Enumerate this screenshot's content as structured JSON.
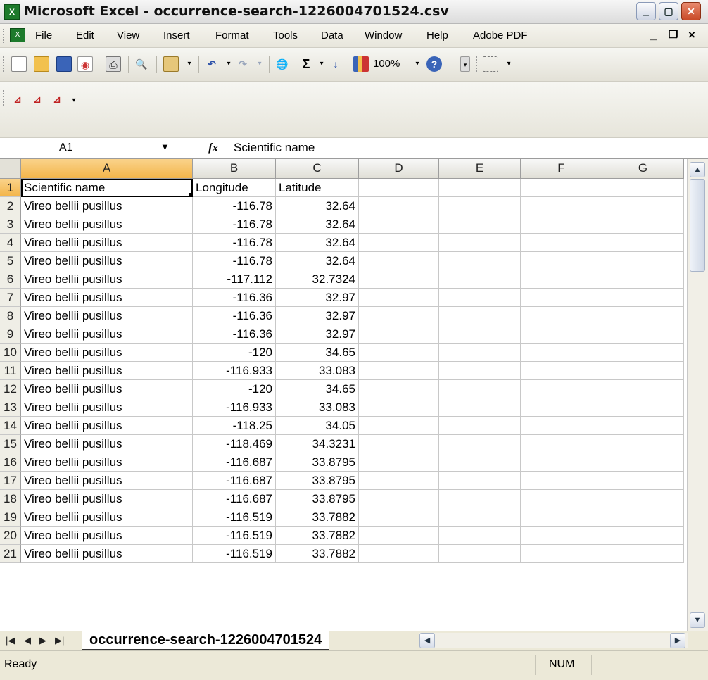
{
  "window": {
    "title": "Microsoft Excel - occurrence-search-1226004701524.csv",
    "app_icon": "excel-icon",
    "controls": [
      "minimize-icon",
      "maximize-icon",
      "close-icon"
    ]
  },
  "menu": {
    "items": [
      "File",
      "Edit",
      "View",
      "Insert",
      "Format",
      "Tools",
      "Data",
      "Window",
      "Help",
      "Adobe PDF"
    ],
    "doc_icon": "workbook-icon",
    "mdi_min": "_",
    "mdi_restore": "❐",
    "mdi_close": "×"
  },
  "toolbar": {
    "icons": [
      "new-icon",
      "open-icon",
      "save-icon",
      "permission-icon",
      "print-icon",
      "research-icon",
      "paste-icon",
      "undo-icon",
      "redo-icon",
      "hyperlink-icon",
      "autosum-icon",
      "sort-ascending-icon",
      "chart-wizard-icon",
      "help-icon",
      "borders-icon"
    ],
    "zoom": "100%",
    "pdf_icons": [
      "convert-to-pdf-icon",
      "convert-and-email-icon",
      "convert-and-review-icon"
    ]
  },
  "formula_bar": {
    "name_box": "A1",
    "fx_label": "fx",
    "content": "Scientific name"
  },
  "sheet": {
    "columns": [
      "A",
      "B",
      "C",
      "D",
      "E",
      "F",
      "G"
    ],
    "active_cell": "A1",
    "rows": [
      {
        "n": "1",
        "a": "Scientific name",
        "b": "Longitude",
        "c": "Latitude"
      },
      {
        "n": "2",
        "a": "Vireo bellii pusillus",
        "b": "-116.78",
        "c": "32.64"
      },
      {
        "n": "3",
        "a": "Vireo bellii pusillus",
        "b": "-116.78",
        "c": "32.64"
      },
      {
        "n": "4",
        "a": "Vireo bellii pusillus",
        "b": "-116.78",
        "c": "32.64"
      },
      {
        "n": "5",
        "a": "Vireo bellii pusillus",
        "b": "-116.78",
        "c": "32.64"
      },
      {
        "n": "6",
        "a": "Vireo bellii pusillus",
        "b": "-117.112",
        "c": "32.7324"
      },
      {
        "n": "7",
        "a": "Vireo bellii pusillus",
        "b": "-116.36",
        "c": "32.97"
      },
      {
        "n": "8",
        "a": "Vireo bellii pusillus",
        "b": "-116.36",
        "c": "32.97"
      },
      {
        "n": "9",
        "a": "Vireo bellii pusillus",
        "b": "-116.36",
        "c": "32.97"
      },
      {
        "n": "10",
        "a": "Vireo bellii pusillus",
        "b": "-120",
        "c": "34.65"
      },
      {
        "n": "11",
        "a": "Vireo bellii pusillus",
        "b": "-116.933",
        "c": "33.083"
      },
      {
        "n": "12",
        "a": "Vireo bellii pusillus",
        "b": "-120",
        "c": "34.65"
      },
      {
        "n": "13",
        "a": "Vireo bellii pusillus",
        "b": "-116.933",
        "c": "33.083"
      },
      {
        "n": "14",
        "a": "Vireo bellii pusillus",
        "b": "-118.25",
        "c": "34.05"
      },
      {
        "n": "15",
        "a": "Vireo bellii pusillus",
        "b": "-118.469",
        "c": "34.3231"
      },
      {
        "n": "16",
        "a": "Vireo bellii pusillus",
        "b": "-116.687",
        "c": "33.8795"
      },
      {
        "n": "17",
        "a": "Vireo bellii pusillus",
        "b": "-116.687",
        "c": "33.8795"
      },
      {
        "n": "18",
        "a": "Vireo bellii pusillus",
        "b": "-116.687",
        "c": "33.8795"
      },
      {
        "n": "19",
        "a": "Vireo bellii pusillus",
        "b": "-116.519",
        "c": "33.7882"
      },
      {
        "n": "20",
        "a": "Vireo bellii pusillus",
        "b": "-116.519",
        "c": "33.7882"
      },
      {
        "n": "21",
        "a": "Vireo bellii pusillus",
        "b": "-116.519",
        "c": "33.7882"
      }
    ]
  },
  "tabs": {
    "nav": [
      "first-sheet-icon",
      "prev-sheet-icon",
      "next-sheet-icon",
      "last-sheet-icon"
    ],
    "sheet_name": "occurrence-search-1226004701524"
  },
  "status": {
    "left": "Ready",
    "num": "NUM"
  },
  "colors": {
    "selected_header": "#f3b54a",
    "excel_green": "#1d7a2b"
  }
}
